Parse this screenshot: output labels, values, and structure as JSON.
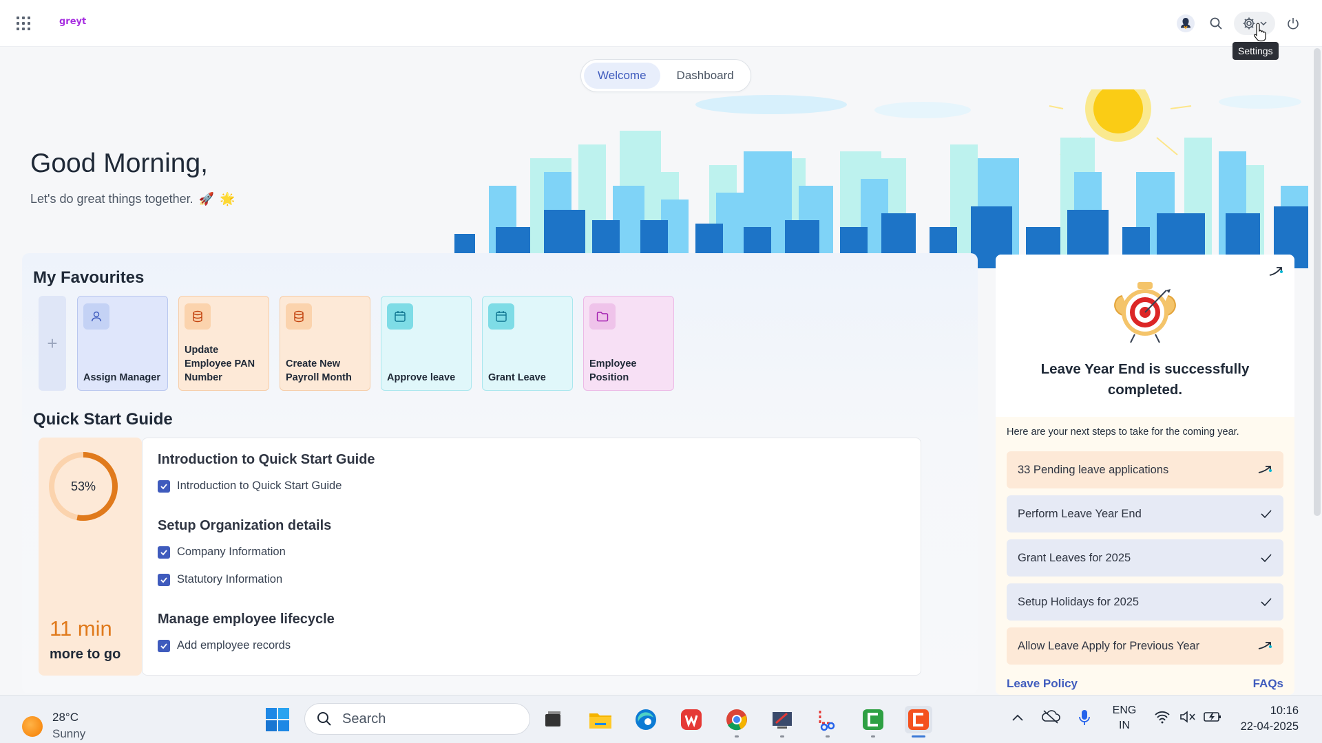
{
  "header": {
    "logo_text": "greyt",
    "tooltip": "Settings"
  },
  "tabs": [
    {
      "label": "Welcome",
      "active": true
    },
    {
      "label": "Dashboard",
      "active": false
    }
  ],
  "greeting": {
    "title": "Good Morning,",
    "subtitle": "Let's do great things together.",
    "emoji1": "🚀",
    "emoji2": "🌟"
  },
  "favourites": {
    "title": "My Favourites",
    "add_symbol": "+",
    "items": [
      {
        "label": "Assign Manager",
        "icon": "user-icon",
        "color": "#dfe6fb"
      },
      {
        "label": "Update Employee PAN Number",
        "icon": "database-icon",
        "color": "#fde9d7"
      },
      {
        "label": "Create New Payroll Month",
        "icon": "database-icon",
        "color": "#fde9d7"
      },
      {
        "label": "Approve leave",
        "icon": "calendar-icon",
        "color": "#e0f7fa"
      },
      {
        "label": "Grant Leave",
        "icon": "calendar-icon",
        "color": "#e0f7fa"
      },
      {
        "label": "Employee Position",
        "icon": "folder-icon",
        "color": "#f7e0f5"
      }
    ]
  },
  "quick_start": {
    "title": "Quick Start Guide",
    "progress_percent": 53,
    "progress_label": "53%",
    "time_left": "11 min",
    "time_suffix": "more to go",
    "sections": [
      {
        "heading": "Introduction to Quick Start Guide",
        "items": [
          "Introduction to Quick Start Guide"
        ]
      },
      {
        "heading": "Setup Organization details",
        "items": [
          "Company Information",
          "Statutory Information"
        ]
      },
      {
        "heading": "Manage employee lifecycle",
        "items": [
          "Add employee records"
        ]
      }
    ]
  },
  "leave_card": {
    "title": "Leave Year End is successfully completed.",
    "subtitle": "Here are your next steps to take for the coming year.",
    "steps": [
      {
        "label": "33 Pending leave applications",
        "status": "pending"
      },
      {
        "label": "Perform Leave Year End",
        "status": "done"
      },
      {
        "label": "Grant Leaves for 2025",
        "status": "done"
      },
      {
        "label": "Setup Holidays for 2025",
        "status": "done"
      },
      {
        "label": "Allow Leave Apply for Previous Year",
        "status": "pending"
      }
    ],
    "link_left": "Leave Policy",
    "link_right": "FAQs"
  },
  "taskbar": {
    "weather_temp": "28°C",
    "weather_cond": "Sunny",
    "search_placeholder": "Search",
    "lang_line1": "ENG",
    "lang_line2": "IN",
    "time": "10:16",
    "date": "22-04-2025"
  },
  "colors": {
    "accent": "#3f5bbd",
    "orange": "#e07a1c",
    "brand": "#a62de0"
  }
}
